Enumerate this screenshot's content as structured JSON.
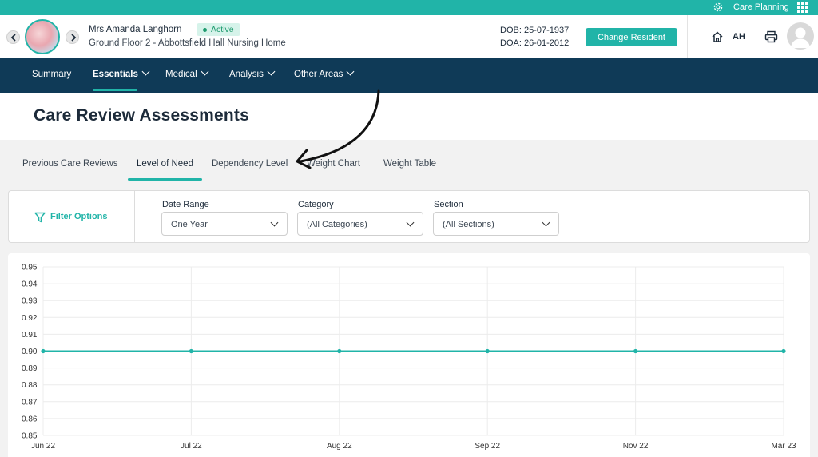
{
  "topbar": {
    "app_label": "Care Planning",
    "icons": [
      "gear-icon",
      "grid-icon"
    ]
  },
  "header": {
    "resident_name": "Mrs Amanda Langhorn",
    "status": "Active",
    "location": "Ground Floor 2 - Abbottsfield Hall Nursing Home",
    "dob": "DOB: 25-07-1937",
    "doa": "DOA: 26-01-2012",
    "change_resident_label": "Change Resident",
    "user_initials": "AH",
    "icons": [
      "chevron-left-icon",
      "chevron-right-icon",
      "home-icon",
      "printer-icon"
    ]
  },
  "nav": {
    "items": [
      {
        "label": "Summary",
        "has_caret": false
      },
      {
        "label": "Essentials",
        "has_caret": true,
        "active": true
      },
      {
        "label": "Medical",
        "has_caret": true
      },
      {
        "label": "Analysis",
        "has_caret": true
      },
      {
        "label": "Other Areas",
        "has_caret": true
      }
    ]
  },
  "page": {
    "title": "Care Review Assessments"
  },
  "tabs": [
    {
      "label": "Previous Care Reviews"
    },
    {
      "label": "Level of Need",
      "active": true
    },
    {
      "label": "Dependency Level"
    },
    {
      "label": "Weight Chart"
    },
    {
      "label": "Weight Table"
    }
  ],
  "filters": {
    "button_label": "Filter Options",
    "date_range": {
      "label": "Date Range",
      "value": "One Year"
    },
    "category": {
      "label": "Category",
      "value": "(All Categories)"
    },
    "section": {
      "label": "Section",
      "value": "(All Sections)"
    }
  },
  "colors": {
    "accent": "#21b4a8",
    "nav_bg": "#0f3a57",
    "text_dark": "#1d2b3a"
  },
  "chart_data": {
    "type": "line",
    "title": "",
    "xlabel": "",
    "ylabel": "",
    "ylim": [
      0.85,
      0.95
    ],
    "yticks": [
      "0.95",
      "0.94",
      "0.93",
      "0.92",
      "0.91",
      "0.90",
      "0.89",
      "0.88",
      "0.87",
      "0.86",
      "0.85"
    ],
    "xticks": [
      "Jun 22",
      "Jul 22",
      "Aug 22",
      "Sep 22",
      "Nov 22",
      "Mar 23"
    ],
    "series": [
      {
        "color": "#21b4a8",
        "values": [
          0.9,
          0.9,
          0.9,
          0.9,
          0.9,
          0.9
        ]
      }
    ],
    "grid": true
  }
}
